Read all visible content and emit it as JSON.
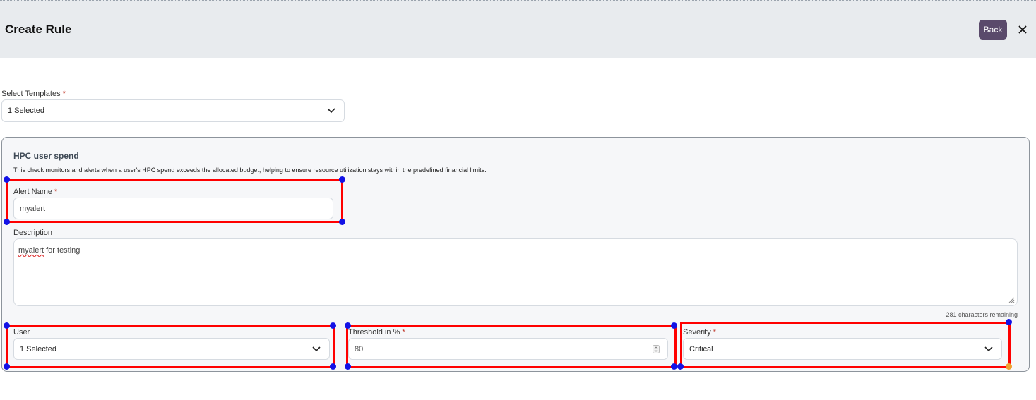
{
  "header": {
    "title": "Create Rule",
    "back_label": "Back"
  },
  "templates": {
    "label": "Select Templates",
    "required_mark": "*",
    "value": "1 Selected"
  },
  "card": {
    "title": "HPC user spend",
    "description": "This check monitors and alerts when a user's HPC spend exceeds the allocated budget, helping to ensure resource utilization stays within the predefined financial limits.",
    "alert_name": {
      "label": "Alert Name",
      "required_mark": "*",
      "value": "myalert"
    },
    "description_field": {
      "label": "Description",
      "value_misspelled": "myalert",
      "value_rest": " for testing",
      "remaining": "281 characters remaining"
    },
    "user": {
      "label": "User",
      "value": "1 Selected"
    },
    "threshold": {
      "label": "Threshold in %",
      "required_mark": "*",
      "value": "80"
    },
    "severity": {
      "label": "Severity",
      "required_mark": "*",
      "value": "Critical"
    }
  },
  "annotation": {
    "highlight_color": "#ff0000",
    "handle_color": "#1212e6",
    "handle_alt_color": "#f0a030"
  },
  "icons": [
    "close-icon",
    "chevron-down-icon",
    "spinner-arrows-icon",
    "resize-grip-icon"
  ]
}
